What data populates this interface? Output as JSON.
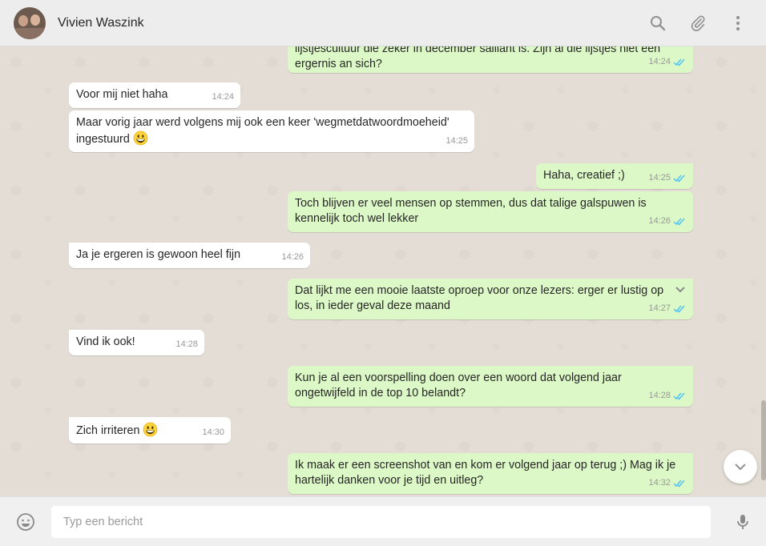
{
  "contact": {
    "name": "Vivien Waszink"
  },
  "header_icons": [
    "search-icon",
    "paperclip-icon",
    "more-vert-icon"
  ],
  "colors": {
    "outgoing_bubble": "#dcf8c6",
    "incoming_bubble": "#ffffff",
    "tick": "#4fc3f7"
  },
  "messages": [
    {
      "dir": "out",
      "lines": [
        "lijstjescultuur die zeker in december saillant is. Zijn al die lijstjes niet een",
        "ergernis an sich?"
      ],
      "time": "14:24",
      "read": true
    },
    {
      "dir": "in",
      "text": "Voor mij niet haha",
      "time": "14:24"
    },
    {
      "dir": "in",
      "lines": [
        "Maar vorig jaar werd volgens mij ook een keer 'wegmetdatwoordmoeheid'",
        "ingestuurd"
      ],
      "emoji": "grinning-face",
      "time": "14:25"
    },
    {
      "dir": "out",
      "text": "Haha, creatief ;)",
      "time": "14:25",
      "read": true
    },
    {
      "dir": "out",
      "lines": [
        "Toch blijven er veel mensen op stemmen, dus dat talige galspuwen is",
        "kennelijk toch wel lekker"
      ],
      "time": "14:26",
      "read": true
    },
    {
      "dir": "in",
      "text": "Ja je ergeren is gewoon heel fijn",
      "time": "14:26"
    },
    {
      "dir": "out",
      "lines": [
        "Dat lijkt me een mooie laatste oproep voor onze lezers: erger er lustig op",
        "los, in ieder geval deze maand"
      ],
      "time": "14:27",
      "read": true
    },
    {
      "dir": "in",
      "text": "Vind ik ook!",
      "time": "14:28"
    },
    {
      "dir": "out",
      "lines": [
        "Kun je al een voorspelling doen over een woord dat volgend jaar",
        "ongetwijfeld in de top 10 belandt?"
      ],
      "time": "14:28",
      "read": true
    },
    {
      "dir": "in",
      "text": "Zich irriteren",
      "emoji": "grinning-face",
      "time": "14:30"
    },
    {
      "dir": "out",
      "lines": [
        "Ik maak er een screenshot van en kom er volgend jaar op terug ;) Mag ik je",
        "hartelijk danken voor je tijd en uitleg?"
      ],
      "time": "14:32",
      "read": true
    }
  ],
  "composer": {
    "placeholder": "Typ een bericht",
    "left_icon": "smiley-icon",
    "right_icon": "microphone-icon"
  }
}
